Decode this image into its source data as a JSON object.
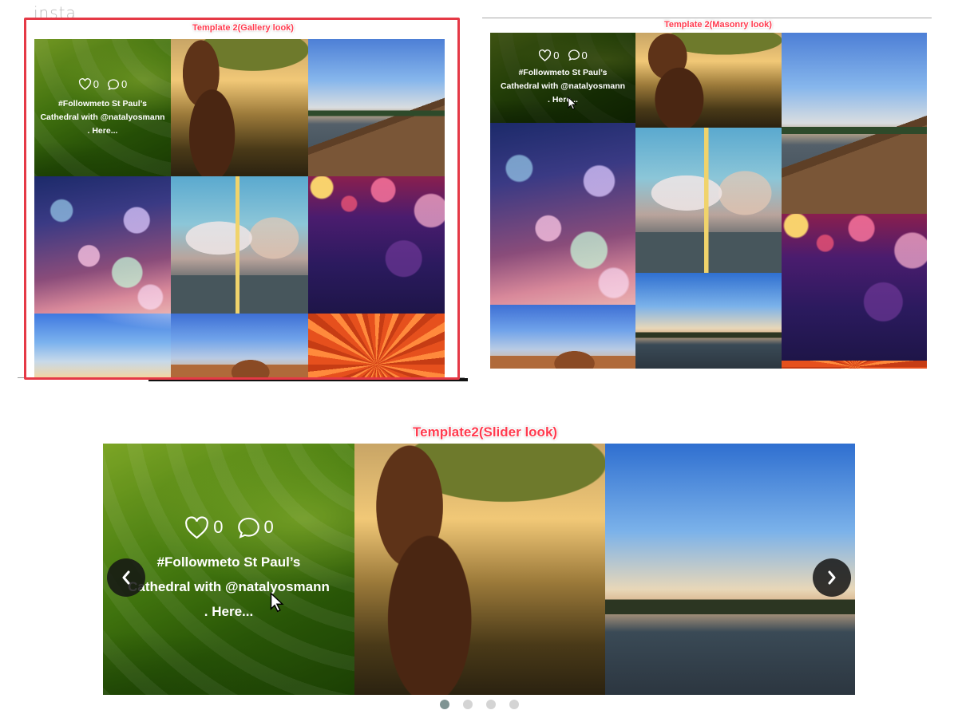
{
  "header": {
    "brand_text": "insta"
  },
  "labels": {
    "gallery": "Template 2(Gallery look)",
    "masonry": "Template 2(Masonry look)",
    "slider": "Template2(Slider look)"
  },
  "post": {
    "likes": "0",
    "comments": "0",
    "caption_line1": "#Followmeto St Paul’s",
    "caption_line2": "Cathedral with @natalyosmann",
    "caption_line3": ". Here..."
  },
  "slider": {
    "slides_total": 4,
    "active_slide": 1
  },
  "icons": {
    "like": "heart-icon",
    "comment": "comment-bubble-icon",
    "prev": "chevron-left-icon",
    "next": "chevron-right-icon"
  },
  "colors": {
    "label_red": "#ff3b4f",
    "frame_red": "#e53946",
    "dot_active": "#7f9493",
    "dot_inactive": "#d4d4d4"
  }
}
